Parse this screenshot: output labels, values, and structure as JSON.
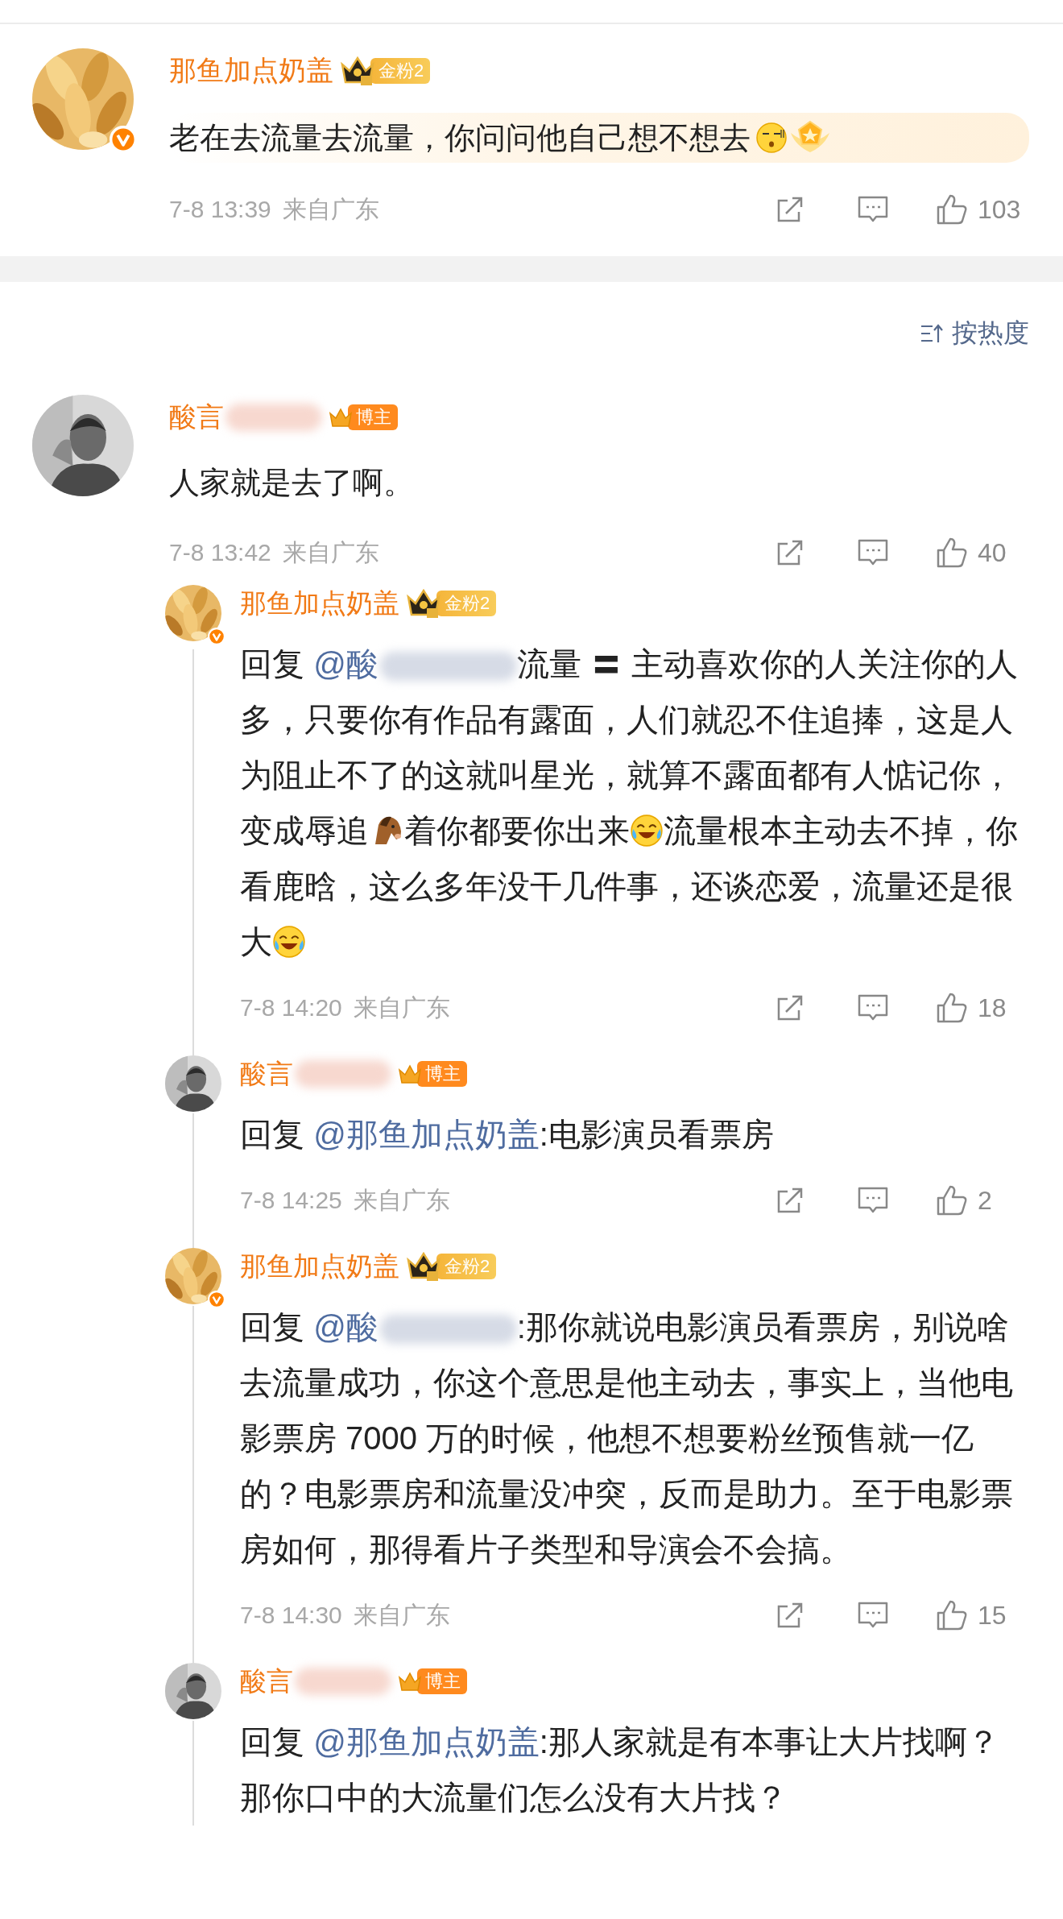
{
  "pinned_comment": {
    "user": {
      "name": "那鱼加点奶盖",
      "name_blurred": false,
      "verified": true,
      "badge": {
        "kind": "fan",
        "label": "金粉2"
      }
    },
    "highlighted": true,
    "body": [
      {
        "kind": "text",
        "text": "老在去流量去流量，你问问他自己想不想去"
      },
      {
        "kind": "sleepy"
      }
    ],
    "time": "7-8 13:39",
    "location": "来自广东",
    "likes": "103"
  },
  "sort": {
    "label": "按热度"
  },
  "thread": {
    "comment": {
      "user": {
        "name": "酸言",
        "name_blurred": true,
        "verified": false,
        "badge": {
          "kind": "blogger",
          "label": "博主"
        }
      },
      "body": [
        {
          "kind": "text",
          "text": "人家就是去了啊。"
        }
      ],
      "time": "7-8 13:42",
      "location": "来自广东",
      "likes": "40"
    },
    "replies": [
      {
        "user": {
          "name": "那鱼加点奶盖",
          "name_blurred": false,
          "verified": true,
          "badge": {
            "kind": "fan",
            "label": "金粉2"
          }
        },
        "body": [
          {
            "kind": "text",
            "text": "回复 "
          },
          {
            "kind": "mention",
            "text": "@酸",
            "blurred": true
          },
          {
            "kind": "text",
            "text": "流量 〓 主动喜欢你的人关注你的人多，只要你有作品有露面，人们就忍不住追捧，这是人为阻止不了的这就叫星光，就算不露面都有人惦记你，变成辱追"
          },
          {
            "kind": "horse"
          },
          {
            "kind": "text",
            "text": "着你都要你出来"
          },
          {
            "kind": "cry-laugh"
          },
          {
            "kind": "text",
            "text": "流量根本主动去不掉，你看鹿晗，这么多年没干几件事，还谈恋爱，流量还是很大"
          },
          {
            "kind": "cry-laugh"
          }
        ],
        "time": "7-8 14:20",
        "location": "来自广东",
        "likes": "18"
      },
      {
        "user": {
          "name": "酸言",
          "name_blurred": true,
          "verified": false,
          "badge": {
            "kind": "blogger",
            "label": "博主"
          }
        },
        "body": [
          {
            "kind": "text",
            "text": "回复 "
          },
          {
            "kind": "mention",
            "text": "@那鱼加点奶盖",
            "blurred": false
          },
          {
            "kind": "text",
            "text": ":电影演员看票房"
          }
        ],
        "time": "7-8 14:25",
        "location": "来自广东",
        "likes": "2"
      },
      {
        "user": {
          "name": "那鱼加点奶盖",
          "name_blurred": false,
          "verified": true,
          "badge": {
            "kind": "fan",
            "label": "金粉2"
          }
        },
        "body": [
          {
            "kind": "text",
            "text": "回复 "
          },
          {
            "kind": "mention",
            "text": "@酸",
            "blurred": true
          },
          {
            "kind": "text",
            "text": ":那你就说电影演员看票房，别说啥去流量成功，你这个意思是他主动去，事实上，当他电影票房 7000 万的时候，他想不想要粉丝预售就一亿的？电影票房和流量没冲突，反而是助力。至于电影票房如何，那得看片子类型和导演会不会搞。"
          }
        ],
        "time": "7-8 14:30",
        "location": "来自广东",
        "likes": "15"
      },
      {
        "user": {
          "name": "酸言",
          "name_blurred": true,
          "verified": false,
          "badge": {
            "kind": "blogger",
            "label": "博主"
          }
        },
        "body": [
          {
            "kind": "text",
            "text": "回复 "
          },
          {
            "kind": "mention",
            "text": "@那鱼加点奶盖",
            "blurred": false
          },
          {
            "kind": "text",
            "text": ":那人家就是有本事让大片找啊？那你口中的大流量们怎么没有大片找？"
          }
        ]
      }
    ]
  }
}
